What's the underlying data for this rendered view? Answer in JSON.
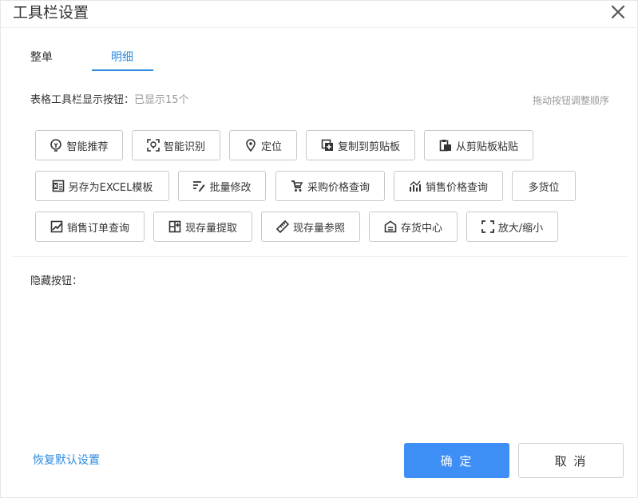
{
  "dialog": {
    "title": "工具栏设置",
    "close_icon": "close-icon"
  },
  "tabs": [
    {
      "label": "整单",
      "active": false
    },
    {
      "label": "明细",
      "active": true
    }
  ],
  "visible_section": {
    "label": "表格工具栏显示按钮：",
    "count_text": "已显示15个",
    "drag_hint": "拖动按钮调整顺序"
  },
  "buttons": [
    {
      "label": "智能推荐",
      "icon": "lightbulb-icon"
    },
    {
      "label": "智能识别",
      "icon": "scan-icon"
    },
    {
      "label": "定位",
      "icon": "location-pin-icon"
    },
    {
      "label": "复制到剪贴板",
      "icon": "copy-icon"
    },
    {
      "label": "从剪贴板粘贴",
      "icon": "paste-icon"
    },
    {
      "label": "另存为EXCEL模板",
      "icon": "excel-icon"
    },
    {
      "label": "批量修改",
      "icon": "batch-edit-icon"
    },
    {
      "label": "采购价格查询",
      "icon": "cart-icon"
    },
    {
      "label": "销售价格查询",
      "icon": "trend-icon"
    },
    {
      "label": "多货位",
      "icon": ""
    },
    {
      "label": "销售订单查询",
      "icon": "chart-line-icon"
    },
    {
      "label": "现存量提取",
      "icon": "grid-plus-icon"
    },
    {
      "label": "现存量参照",
      "icon": "ruler-icon"
    },
    {
      "label": "存货中心",
      "icon": "warehouse-icon"
    },
    {
      "label": "放大/缩小",
      "icon": "expand-icon"
    }
  ],
  "hidden_section": {
    "label": "隐藏按钮："
  },
  "footer": {
    "restore_label": "恢复默认设置",
    "ok_label": "确 定",
    "cancel_label": "取 消"
  },
  "colors": {
    "accent": "#2b8be0",
    "primary_button": "#3d8ef5",
    "muted_text": "#999999"
  }
}
